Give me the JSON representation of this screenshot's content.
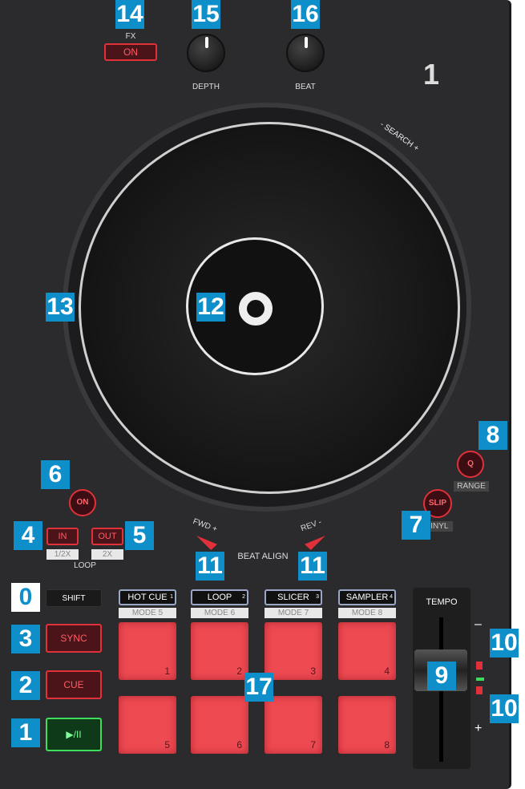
{
  "deck_number": "1",
  "fx": {
    "label": "FX",
    "on_button": "ON"
  },
  "knobs": [
    {
      "label": "DEPTH"
    },
    {
      "label": "BEAT"
    }
  ],
  "search_label": "SEARCH",
  "search_minus": "-",
  "search_plus": "+",
  "slip": {
    "label": "SLIP",
    "sub": "VINYL"
  },
  "quant": {
    "label": "Q",
    "sub": "RANGE"
  },
  "loop": {
    "on": "ON",
    "in": "IN",
    "out": "OUT",
    "in_sub": "1/2X",
    "out_sub": "2X",
    "title": "LOOP"
  },
  "beat_align": {
    "fwd": "FWD +",
    "rev": "REV -",
    "title": "BEAT ALIGN"
  },
  "transport": {
    "shift": "SHIFT",
    "sync": "SYNC",
    "cue": "CUE",
    "play": "▶/II"
  },
  "modes": [
    {
      "label": "HOT CUE",
      "num": "1",
      "sub": "MODE 5"
    },
    {
      "label": "LOOP",
      "num": "2",
      "sub": "MODE 6"
    },
    {
      "label": "SLICER",
      "num": "3",
      "sub": "MODE 7"
    },
    {
      "label": "SAMPLER",
      "num": "4",
      "sub": "MODE 8"
    }
  ],
  "pads": [
    "1",
    "2",
    "3",
    "4",
    "5",
    "6",
    "7",
    "8"
  ],
  "tempo": {
    "label": "TEMPO",
    "minus": "–",
    "plus": "+"
  },
  "callouts": [
    "14",
    "15",
    "16",
    "13",
    "12",
    "8",
    "6",
    "7",
    "4",
    "5",
    "11",
    "11",
    "0",
    "3",
    "10",
    "9",
    "2",
    "17",
    "10",
    "1"
  ],
  "colors": {
    "callout": "#0f8fc9",
    "pad": "#ee4a52",
    "play": "#3ddc5a",
    "accent_red": "#e0303a"
  }
}
